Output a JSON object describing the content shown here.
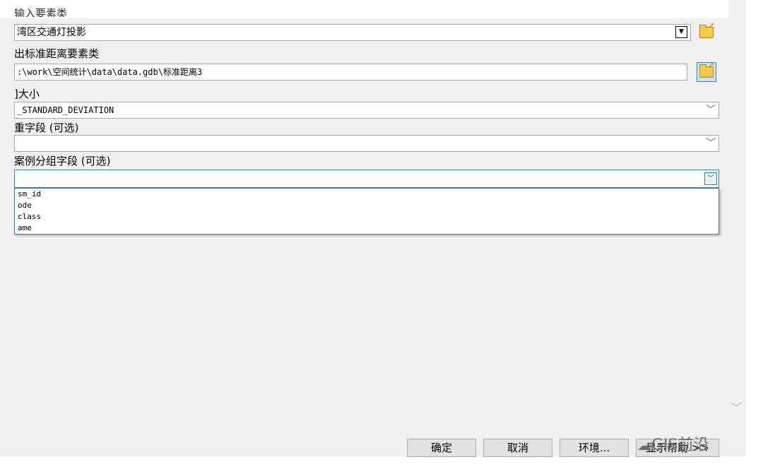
{
  "labels": {
    "input_partial": "输入要素类",
    "output": "出标准距离要素类",
    "circle_size": "]大小",
    "weight_field": "重字段 (可选)",
    "case_field": "案例分组字段 (可选)"
  },
  "fields": {
    "input_value": "湾区交通灯投影",
    "output_value": ":\\work\\空间统计\\data\\data.gdb\\标准距离3",
    "circle_size_value": "_STANDARD_DEVIATION",
    "weight_value": "",
    "case_value": ""
  },
  "dropdown_options": [
    "sm_id",
    "ode",
    "class",
    "ame"
  ],
  "buttons": {
    "ok": "确定",
    "cancel": "取消",
    "environments": "环境...",
    "show_help": "显示帮助 >>"
  },
  "watermark": "GIS前沿",
  "icons": {
    "folder": "open-folder-icon",
    "dropdown": "chevron-down-icon",
    "wechat": "wechat-icon"
  },
  "colors": {
    "dialog_bg": "#f0f0f0",
    "accent_border": "#3c7fb1"
  }
}
